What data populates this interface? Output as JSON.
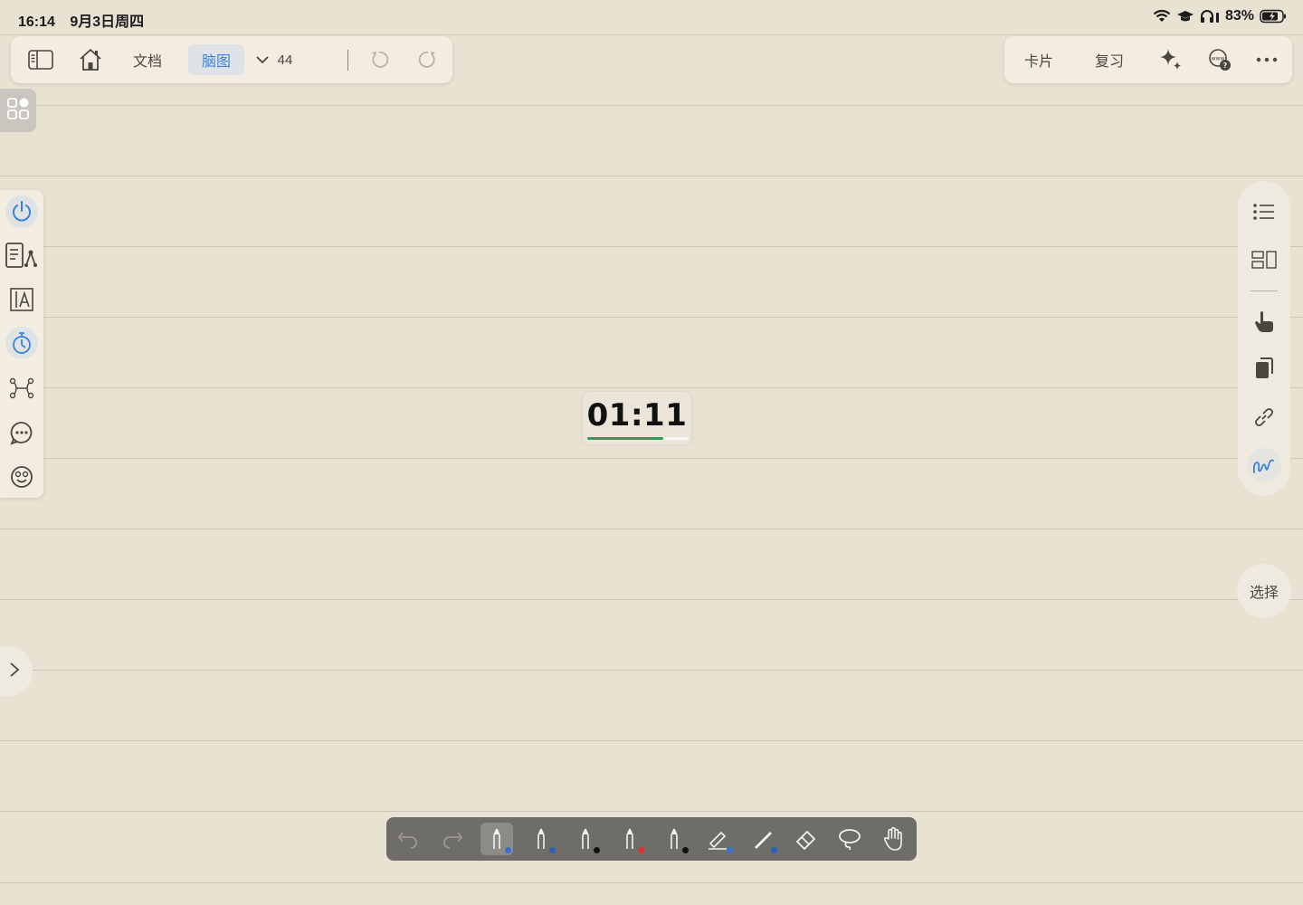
{
  "status_bar": {
    "time": "16:14",
    "date": "9月3日周四",
    "battery": "83%",
    "icons": [
      "wifi-icon",
      "graduation-cap-icon",
      "headphones-icon",
      "battery-charging-icon"
    ]
  },
  "top_toolbar": {
    "doc_label": "文档",
    "mindmap_label": "脑图",
    "count": "44",
    "icons": [
      "sidebar-toggle-icon",
      "home-icon",
      "chevron-down-icon",
      "undo-icon",
      "redo-icon"
    ]
  },
  "top_right_toolbar": {
    "card_label": "卡片",
    "review_label": "复习",
    "icons": [
      "ai-sparkle-icon",
      "web-search-icon",
      "more-icon"
    ]
  },
  "left_sidebar": {
    "icons": [
      "power-icon",
      "outline-tree-icon",
      "text-box-icon",
      "timer-icon",
      "connections-icon",
      "chat-bubble-icon",
      "emoji-icon"
    ]
  },
  "right_sidebar": {
    "icons": [
      "list-icon",
      "layout-icon",
      "pointer-hand-icon",
      "copy-icon",
      "link-icon",
      "handwriting-icon"
    ],
    "select_label": "选择"
  },
  "timer": {
    "value": "01:11",
    "progress": 0.75,
    "progress_color": "#2f9a5a"
  },
  "pen_toolbar": {
    "tools": [
      {
        "name": "undo-icon"
      },
      {
        "name": "redo-icon"
      },
      {
        "name": "pen-icon",
        "color": "#3b6fd1",
        "active": true
      },
      {
        "name": "pen-icon",
        "color": "#2f5fb8"
      },
      {
        "name": "pen-icon",
        "color": "#111111"
      },
      {
        "name": "pen-icon",
        "color": "#e03030"
      },
      {
        "name": "pen-icon",
        "color": "#111111"
      },
      {
        "name": "highlighter-icon",
        "color": "#3b6fd1"
      },
      {
        "name": "pencil-icon",
        "color": "#2f5fb8"
      },
      {
        "name": "eraser-icon"
      },
      {
        "name": "lasso-icon"
      },
      {
        "name": "hand-pan-icon"
      }
    ]
  },
  "colors": {
    "background": "#e8e2d2",
    "accent": "#3b82d6"
  }
}
